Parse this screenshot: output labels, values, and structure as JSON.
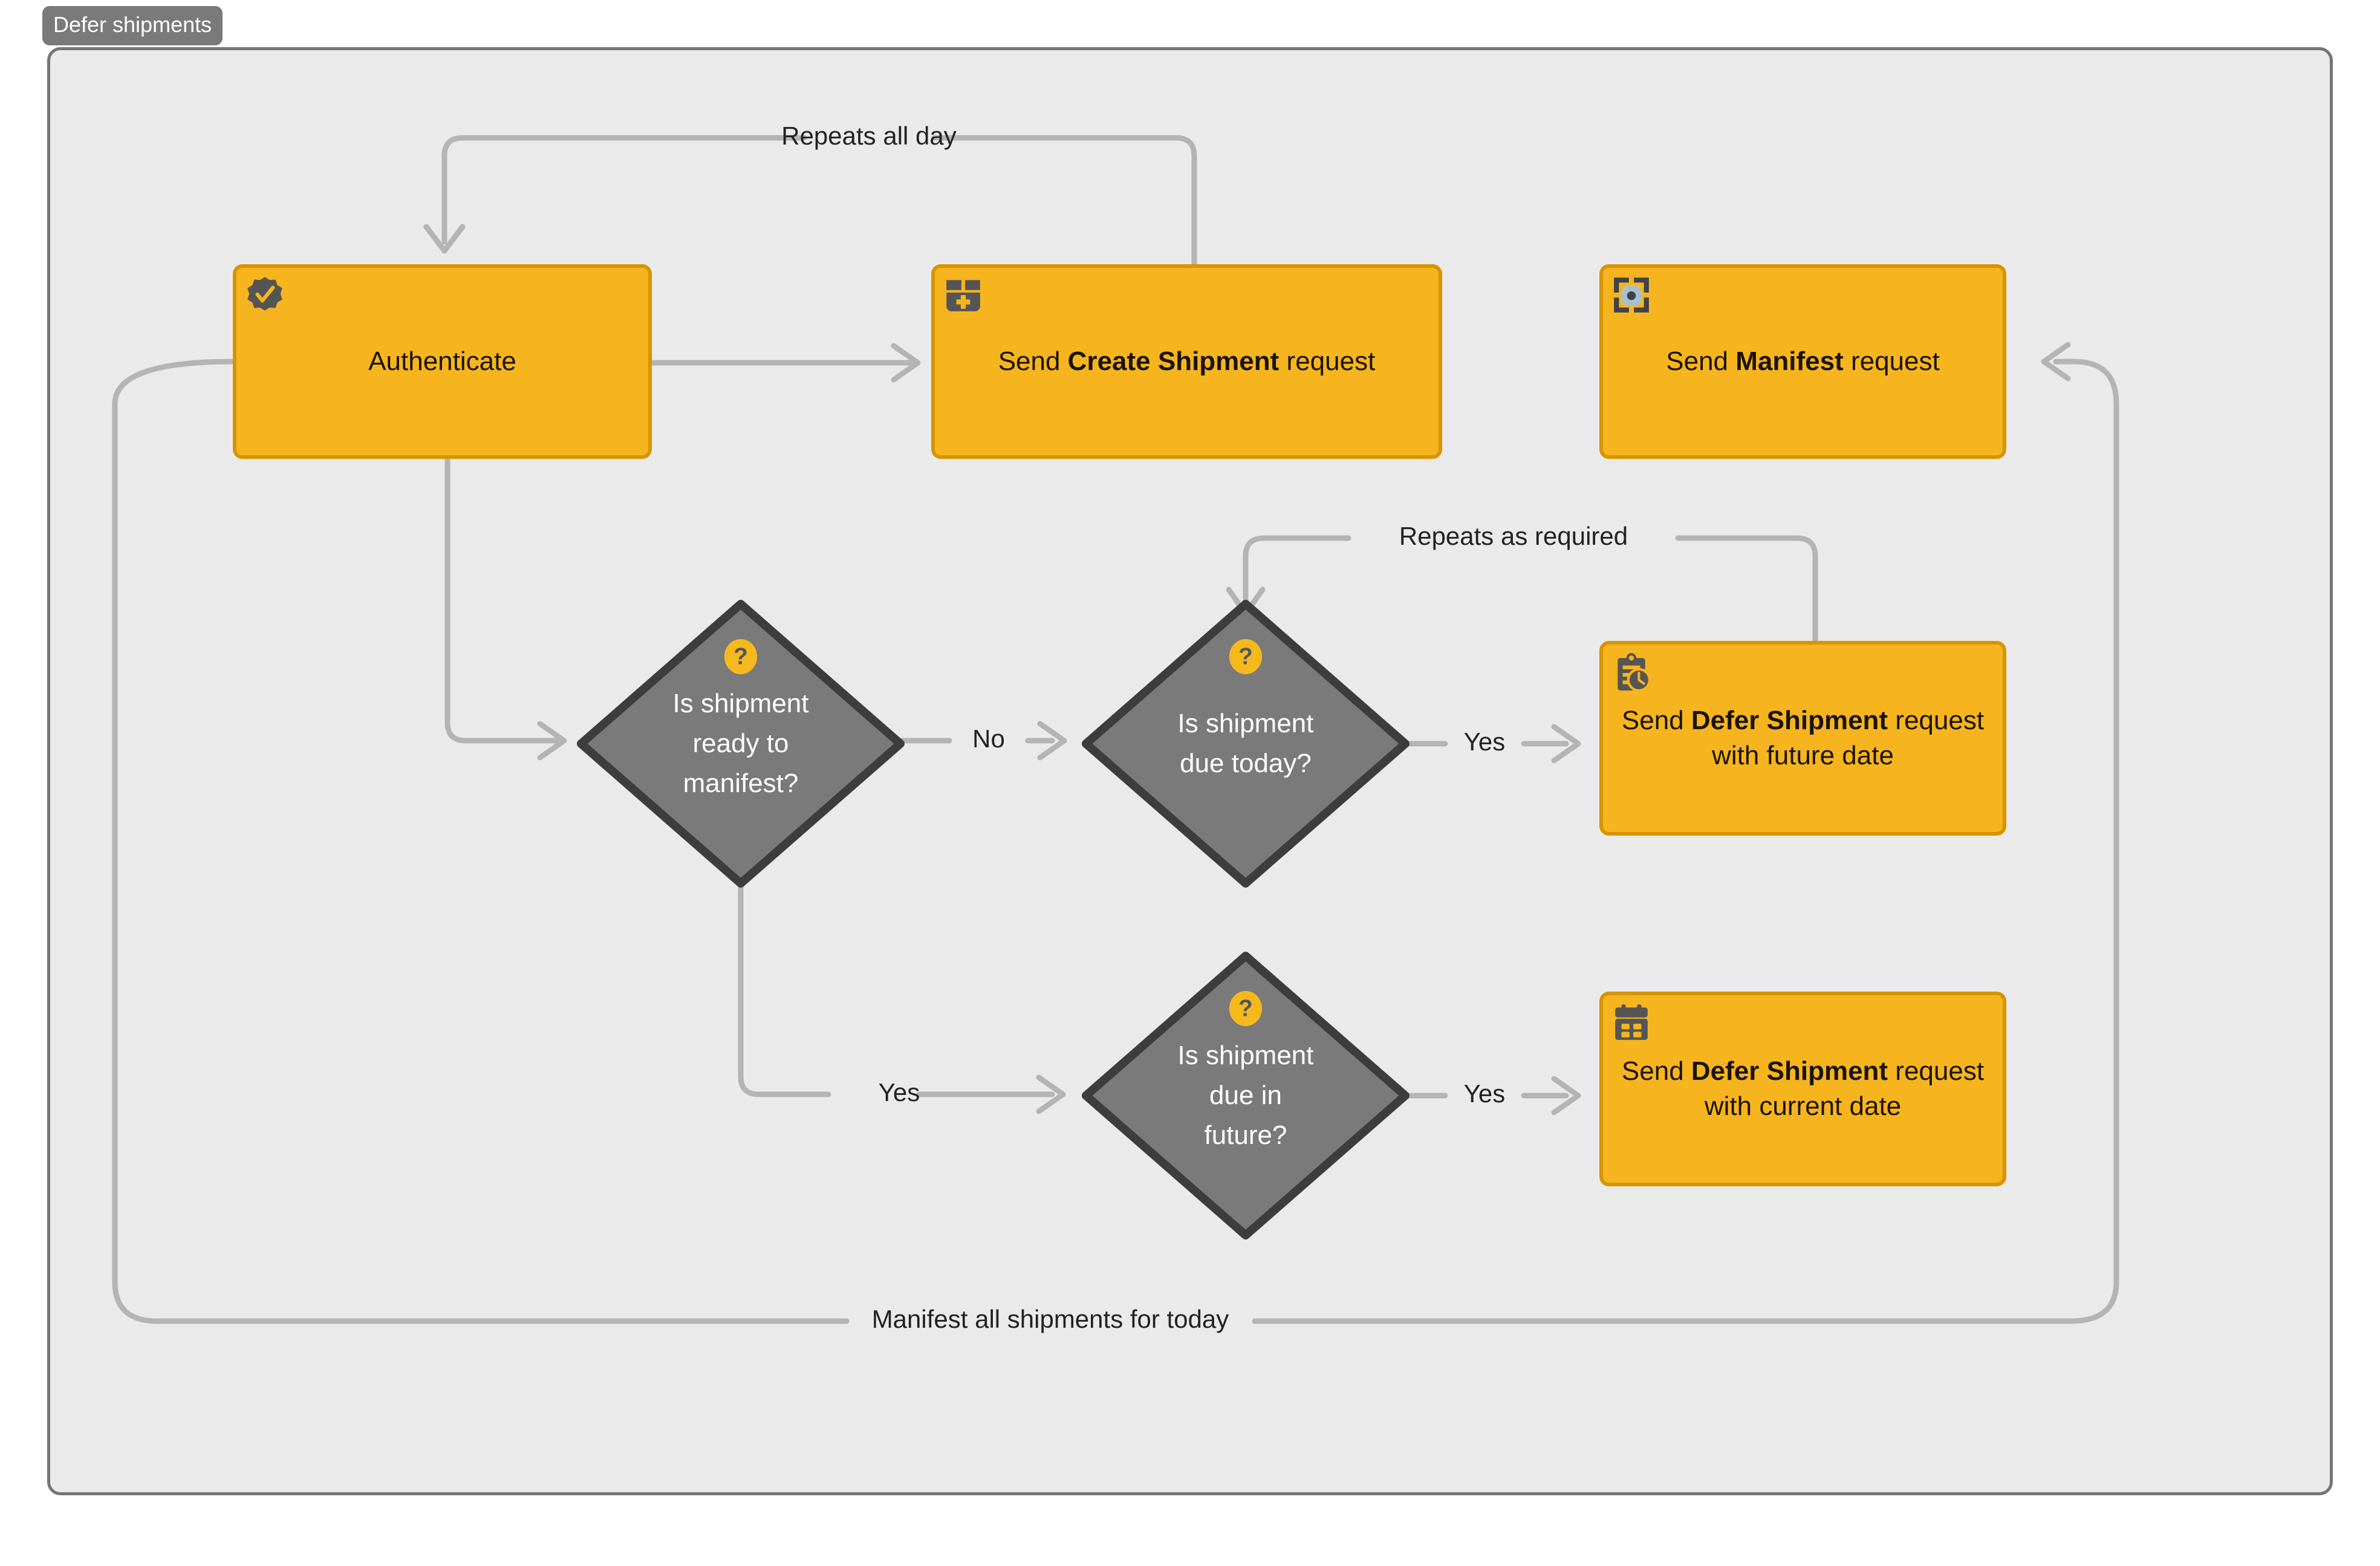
{
  "diagram": {
    "title": "Defer shipments",
    "type": "flowchart",
    "colors": {
      "process_fill": "#f6b51e",
      "process_border": "#d79400",
      "decision_fill": "#7a7a7a",
      "decision_border": "#3d3d3d",
      "edge": "#b4b4b4",
      "container_fill": "#eaeaea",
      "container_border": "#757575",
      "title_badge": "#7a7a7a",
      "icon_dark": "#555555",
      "badge_amber": "#f5b91d"
    },
    "nodes": [
      {
        "id": "authenticate",
        "shape": "process",
        "icon": "verified-badge-icon",
        "text_prefix": "Authenticate",
        "text_bold": "",
        "text_suffix": ""
      },
      {
        "id": "create-shipment",
        "shape": "process",
        "icon": "box-plus-icon",
        "text_prefix": "Send ",
        "text_bold": "Create Shipment",
        "text_suffix": " request"
      },
      {
        "id": "manifest",
        "shape": "process",
        "icon": "frame-gear-icon",
        "text_prefix": "Send ",
        "text_bold": "Manifest",
        "text_suffix": " request"
      },
      {
        "id": "ready-to-manifest",
        "shape": "decision",
        "icon": "question-badge-icon",
        "line1": "Is shipment",
        "line2": "ready to",
        "line3": "manifest?"
      },
      {
        "id": "due-today",
        "shape": "decision",
        "icon": "question-badge-icon",
        "line1": "Is shipment",
        "line2": "due today?",
        "line3": ""
      },
      {
        "id": "due-in-future",
        "shape": "decision",
        "icon": "question-badge-icon",
        "line1": "Is shipment",
        "line2": "due in",
        "line3": "future?"
      },
      {
        "id": "defer-future-date",
        "shape": "process",
        "icon": "clipboard-clock-icon",
        "text_prefix": "Send ",
        "text_bold": "Defer Shipment",
        "text_suffix": " request with future date"
      },
      {
        "id": "defer-current-date",
        "shape": "process",
        "icon": "calendar-icon",
        "text_prefix": "Send ",
        "text_bold": "Defer Shipment",
        "text_suffix": " request with current date"
      }
    ],
    "edges": [
      {
        "id": "repeats-all-day",
        "from": "create-shipment",
        "to": "authenticate",
        "label": "Repeats all day"
      },
      {
        "id": "auth-to-create",
        "from": "authenticate",
        "to": "create-shipment",
        "label": ""
      },
      {
        "id": "auth-to-ready",
        "from": "authenticate",
        "to": "ready-to-manifest",
        "label": ""
      },
      {
        "id": "ready-no",
        "from": "ready-to-manifest",
        "to": "due-today",
        "label": "No"
      },
      {
        "id": "ready-yes",
        "from": "ready-to-manifest",
        "to": "due-in-future",
        "label": "Yes"
      },
      {
        "id": "due-today-yes",
        "from": "due-today",
        "to": "defer-future-date",
        "label": "Yes"
      },
      {
        "id": "repeats-as-required",
        "from": "defer-future-date",
        "to": "due-today",
        "label": "Repeats as required"
      },
      {
        "id": "due-future-yes",
        "from": "due-in-future",
        "to": "defer-current-date",
        "label": "Yes"
      },
      {
        "id": "manifest-loop",
        "from": "authenticate",
        "to": "manifest",
        "label": "Manifest all shipments for today"
      }
    ],
    "edge_labels": {
      "repeats_all_day": "Repeats all day",
      "repeats_as_required": "Repeats as required",
      "manifest_all": "Manifest all shipments for today",
      "no": "No",
      "yes_ready": "Yes",
      "yes_due_today": "Yes",
      "yes_due_future": "Yes"
    }
  }
}
